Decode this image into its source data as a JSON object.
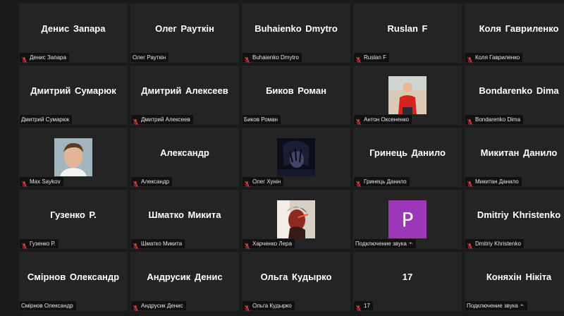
{
  "participants": [
    {
      "name": "Денис Запара",
      "label": "Денис Запара",
      "muted": true
    },
    {
      "name": "Олег Рауткін",
      "label": "Олег Рауткін",
      "muted": false
    },
    {
      "name": "Buhaienko Dmytro",
      "label": "Buhaienko Dmytro",
      "muted": true
    },
    {
      "name": "Ruslan F",
      "label": "Ruslan F",
      "muted": true
    },
    {
      "name": "Коля Гавриленко",
      "label": "Коля Гавриленко",
      "muted": true
    },
    {
      "name": "Дмитрий Сумарюк",
      "label": "Дмитрий Сумарюк",
      "muted": false
    },
    {
      "name": "Дмитрий Алексеев",
      "label": "Дмитрий Алексеев",
      "muted": true
    },
    {
      "name": "Биков Роман",
      "label": "Биков Роман",
      "muted": false
    },
    {
      "name": "",
      "label": "Антон Оксененко",
      "muted": true,
      "avatar": "photo-person-red-shirt"
    },
    {
      "name": "Bondarenko Dima",
      "label": "Bondarenko Dima",
      "muted": true
    },
    {
      "name": "",
      "label": "Max Saykov",
      "muted": true,
      "avatar": "photo-person-face"
    },
    {
      "name": "Александр",
      "label": "Александр",
      "muted": true
    },
    {
      "name": "",
      "label": "Олег Хунін",
      "muted": true,
      "avatar": "photo-dark-anime"
    },
    {
      "name": "Гринець Данило",
      "label": "Гринець Данило",
      "muted": true
    },
    {
      "name": "Микитан Данило",
      "label": "Микитан Данило",
      "muted": true
    },
    {
      "name": "Гузенко Р.",
      "label": "Гузенко Р.",
      "muted": true
    },
    {
      "name": "Шматко Микита",
      "label": "Шматко Микита",
      "muted": true
    },
    {
      "name": "",
      "label": "Харченко Лера",
      "muted": true,
      "avatar": "photo-person-red-light"
    },
    {
      "name": "",
      "label": "Подключение звука",
      "muted": false,
      "letter": "P",
      "dots": "·•·"
    },
    {
      "name": "Dmitriy Khristenko",
      "label": "Dmitriy Khristenko",
      "muted": true
    },
    {
      "name": "Смірнов Олександр",
      "label": "Смірнов Олександр",
      "muted": false
    },
    {
      "name": "Андрусик Денис",
      "label": "Андрусик Денис",
      "muted": true
    },
    {
      "name": "Ольга Кудырко",
      "label": "Ольга Кудырко",
      "muted": true
    },
    {
      "name": "17",
      "label": "17",
      "muted": true
    },
    {
      "name": "Коняхін Нікіта",
      "label": "Подключение звука",
      "muted": false,
      "dots": "·•·"
    }
  ],
  "colors": {
    "background": "#1a1a1a",
    "tile": "#242424",
    "muted_icon": "#e0393e",
    "letter_avatar": "#9b37b8"
  },
  "icons": {
    "muted": "microphone-muted-icon"
  }
}
